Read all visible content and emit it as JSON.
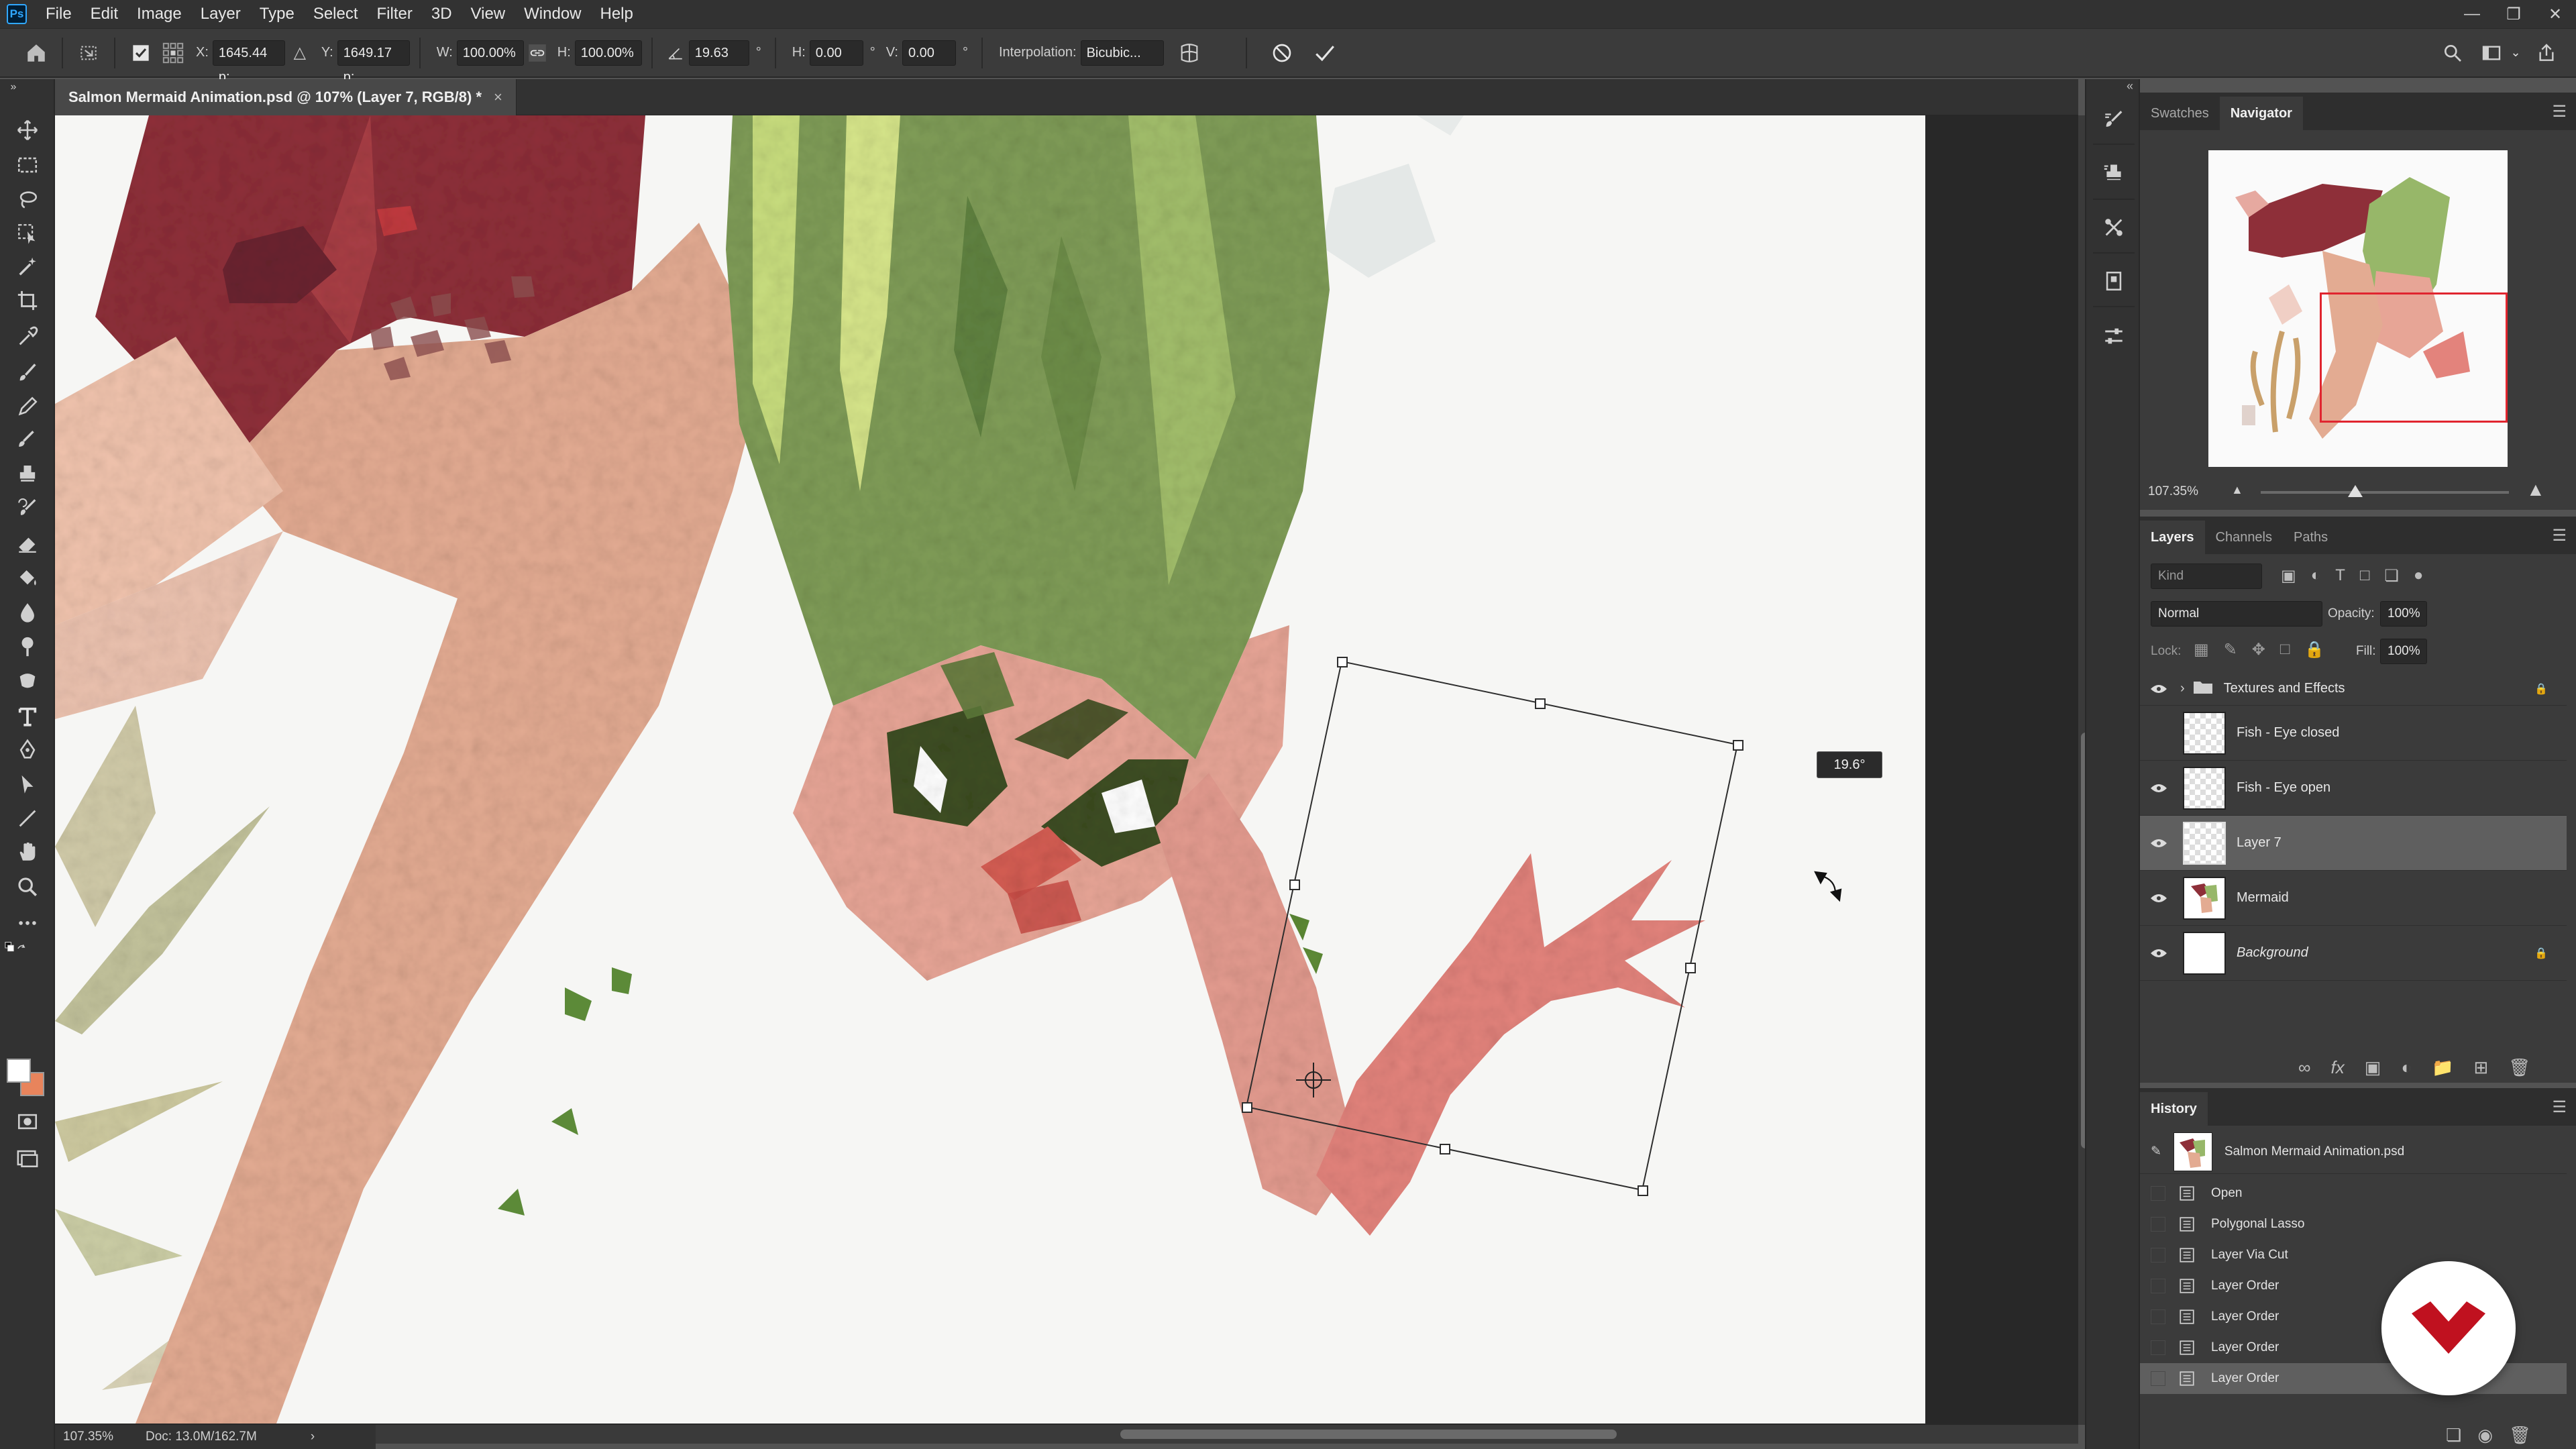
{
  "app": {
    "logo_text": "Ps"
  },
  "menu": [
    "File",
    "Edit",
    "Image",
    "Layer",
    "Type",
    "Select",
    "Filter",
    "3D",
    "View",
    "Window",
    "Help"
  ],
  "options_bar": {
    "x_label": "X:",
    "x_value": "1645.44 p:",
    "y_label": "Y:",
    "y_value": "1649.17 p:",
    "w_label": "W:",
    "w_value": "100.00%",
    "h_label": "H:",
    "h_value": "100.00%",
    "angle_value": "19.63",
    "angle_unit": "°",
    "hskew_label": "H:",
    "hskew_value": "0.00",
    "vskew_label": "V:",
    "vskew_value": "0.00",
    "interpolation_label": "Interpolation:",
    "interpolation_value": "Bicubic..."
  },
  "document": {
    "tab_title": "Salmon Mermaid Animation.psd @ 107% (Layer 7, RGB/8) *",
    "tab_close": "×",
    "rotation_readout": "19.6°"
  },
  "status": {
    "zoom": "107.35%",
    "doc_size": "Doc: 13.0M/162.7M"
  },
  "navigator": {
    "tabs": [
      "Swatches",
      "Navigator"
    ],
    "active_tab": "Navigator",
    "zoom": "107.35%",
    "zoom_fraction": 0.38
  },
  "layers_panel": {
    "tabs": [
      "Layers",
      "Channels",
      "Paths"
    ],
    "active_tab": "Layers",
    "filter_placeholder": "Kind",
    "blend_mode": "Normal",
    "opacity_label": "Opacity:",
    "opacity_value": "100%",
    "lock_label": "Lock:",
    "fill_label": "Fill:",
    "fill_value": "100%",
    "layers": [
      {
        "name": "Textures and Effects",
        "visible": true,
        "type": "group",
        "locked": true,
        "selected": false
      },
      {
        "name": "Fish - Eye closed",
        "visible": false,
        "type": "layer",
        "locked": false,
        "selected": false
      },
      {
        "name": "Fish - Eye open",
        "visible": true,
        "type": "layer",
        "locked": false,
        "selected": false
      },
      {
        "name": "Layer 7",
        "visible": true,
        "type": "layer",
        "locked": false,
        "selected": true
      },
      {
        "name": "Mermaid",
        "visible": true,
        "type": "layer",
        "locked": false,
        "selected": false
      },
      {
        "name": "Background",
        "visible": true,
        "type": "layer",
        "locked": true,
        "selected": false,
        "italic": true
      }
    ]
  },
  "history_panel": {
    "title": "History",
    "snapshot": "Salmon Mermaid Animation.psd",
    "steps": [
      "Open",
      "Polygonal Lasso",
      "Layer Via Cut",
      "Layer Order",
      "Layer Order",
      "Layer Order",
      "Layer Order"
    ],
    "selected_index": 6
  },
  "colors": {
    "accent": "#31a8ff",
    "watermark_red": "#c0111f",
    "nav_view_box": "#e0252f"
  }
}
